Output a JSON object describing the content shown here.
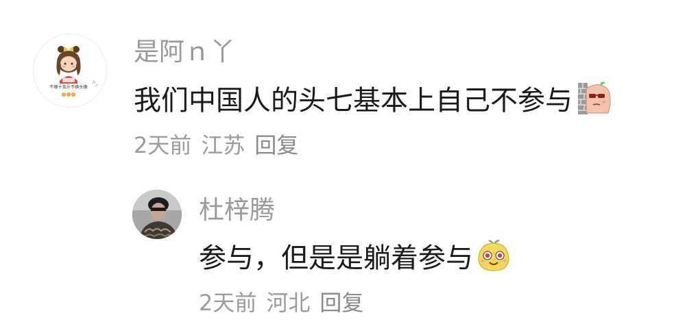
{
  "comments": [
    {
      "username": "是阿ｎ丫",
      "text": "我们中国人的头七基本上自己不参与",
      "emoji_icon": "peeking-behind-wall-icon",
      "time": "2天前",
      "location": "江苏",
      "reply_label": "回复",
      "avatar_icon": "cartoon-girl-avatar-icon",
      "avatar_caption": "不瘦十五斤不换头像",
      "replies": [
        {
          "username": "杜梓腾",
          "text": "参与，但是是躺着参与",
          "emoji_icon": "sly-face-icon",
          "time": "2天前",
          "location": "河北",
          "reply_label": "回复",
          "avatar_icon": "user-photo-avatar-icon"
        }
      ]
    }
  ],
  "colors": {
    "background": "#ffffff",
    "username": "#999999",
    "body_text": "#1a1a1a",
    "meta_text": "#9b9b9b"
  }
}
